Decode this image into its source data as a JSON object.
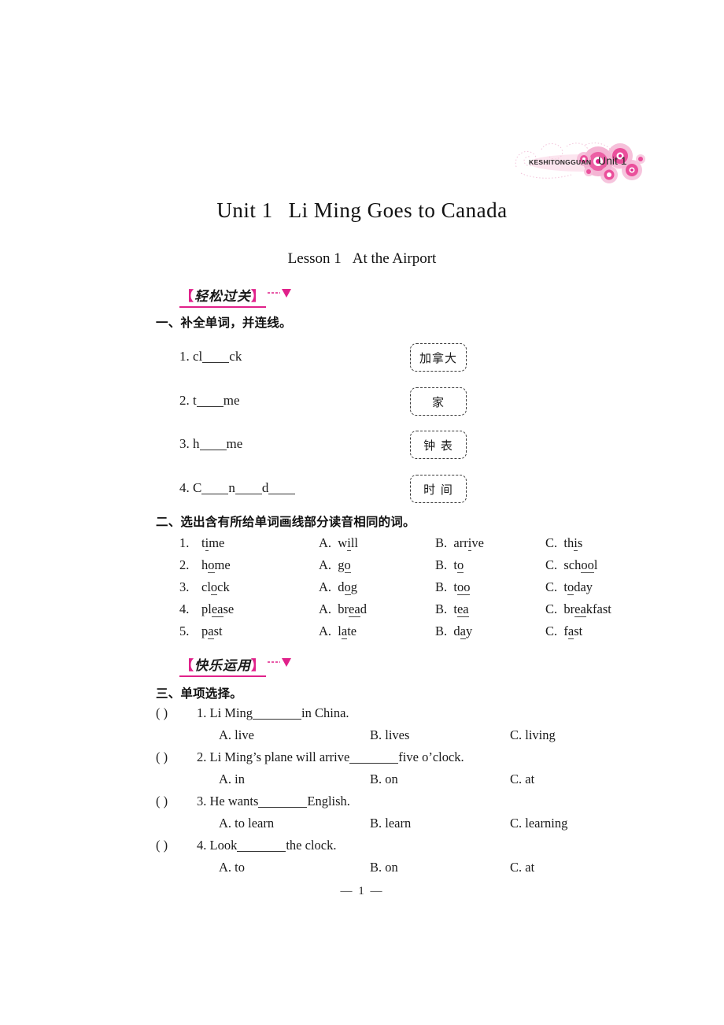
{
  "logo": {
    "wordmark": "KESHITONGGUAN",
    "unit_label": "Unit 1",
    "accent_color": "#e8509a",
    "accent_light": "#f7b9d6"
  },
  "header": {
    "unit_title_left": "Unit 1",
    "unit_title_right": "Li Ming Goes to Canada",
    "lesson_title_left": "Lesson 1",
    "lesson_title_right": "At the Airport"
  },
  "badges": {
    "easy_pass": {
      "open_bracket": "【",
      "text": "轻松过关",
      "close_bracket": "】",
      "color": "#e0218a"
    },
    "happy_use": {
      "open_bracket": "【",
      "text": "快乐运用",
      "close_bracket": "】",
      "color": "#e0218a"
    }
  },
  "section1": {
    "heading": "一、补全单词，并连线。",
    "items": [
      {
        "num": "1.",
        "pre": "cl",
        "post": "ck",
        "blank": "md"
      },
      {
        "num": "2.",
        "pre": "t",
        "post": "me",
        "blank": "md"
      },
      {
        "num": "3.",
        "pre": "h",
        "post": "me",
        "blank": "sm"
      },
      {
        "num": "4.",
        "pre": "C",
        "mid1": "n",
        "mid2": "d",
        "post": "",
        "blank": "md"
      }
    ],
    "item4_text": "4.  C",
    "boxes": [
      "加拿大",
      "家",
      "钟  表",
      "时  间"
    ]
  },
  "section2": {
    "heading": "二、选出含有所给单词画线部分读音相同的词。",
    "rows": [
      {
        "num": "1.",
        "word": {
          "pre": "t",
          "u": "i",
          "post": "me"
        },
        "a": {
          "label": "A.",
          "pre": "w",
          "u": "i",
          "post": "ll"
        },
        "b": {
          "label": "B.",
          "pre": "arr",
          "u": "i",
          "post": "ve"
        },
        "c": {
          "label": "C.",
          "pre": "th",
          "u": "i",
          "post": "s"
        }
      },
      {
        "num": "2.",
        "word": {
          "pre": "h",
          "u": "o",
          "post": "me"
        },
        "a": {
          "label": "A.",
          "pre": "g",
          "u": "o",
          "post": ""
        },
        "b": {
          "label": "B.",
          "pre": "t",
          "u": "o",
          "post": ""
        },
        "c": {
          "label": "C.",
          "pre": "sch",
          "u": "oo",
          "post": "l"
        }
      },
      {
        "num": "3.",
        "word": {
          "pre": "cl",
          "u": "o",
          "post": "ck"
        },
        "a": {
          "label": "A.",
          "pre": "d",
          "u": "o",
          "post": "g"
        },
        "b": {
          "label": "B.",
          "pre": "t",
          "u": "oo",
          "post": ""
        },
        "c": {
          "label": "C.",
          "pre": "t",
          "u": "o",
          "post": "day"
        }
      },
      {
        "num": "4.",
        "word": {
          "pre": "pl",
          "u": "ea",
          "post": "se"
        },
        "a": {
          "label": "A.",
          "pre": "br",
          "u": "ea",
          "post": "d"
        },
        "b": {
          "label": "B.",
          "pre": "t",
          "u": "ea",
          "post": ""
        },
        "c": {
          "label": "C.",
          "pre": "br",
          "u": "ea",
          "post": "kfast"
        }
      },
      {
        "num": "5.",
        "word": {
          "pre": "p",
          "u": "a",
          "post": "st"
        },
        "a": {
          "label": "A.",
          "pre": "l",
          "u": "a",
          "post": "te"
        },
        "b": {
          "label": "B.",
          "pre": "d",
          "u": "a",
          "post": "y"
        },
        "c": {
          "label": "C.",
          "pre": "f",
          "u": "a",
          "post": "st"
        }
      }
    ]
  },
  "section3": {
    "heading": "三、单项选择。",
    "paren": "(        )",
    "questions": [
      {
        "num": "1.",
        "stem_pre": "Li Ming",
        "stem_post": "in China.",
        "a": "A.  live",
        "b": "B.  lives",
        "c": "C.  living"
      },
      {
        "num": "2.",
        "stem_pre": "Li Ming’s plane will arrive",
        "stem_post": "five o’clock.",
        "a": "A.  in",
        "b": "B.  on",
        "c": "C.  at"
      },
      {
        "num": "3.",
        "stem_pre": "He wants",
        "stem_post": "English.",
        "a": "A.  to learn",
        "b": "B.  learn",
        "c": "C.  learning"
      },
      {
        "num": "4.",
        "stem_pre": "Look",
        "stem_post": "the clock.",
        "a": "A.  to",
        "b": "B.  on",
        "c": "C.  at"
      }
    ]
  },
  "footer": {
    "page_number": "— 1 —"
  }
}
